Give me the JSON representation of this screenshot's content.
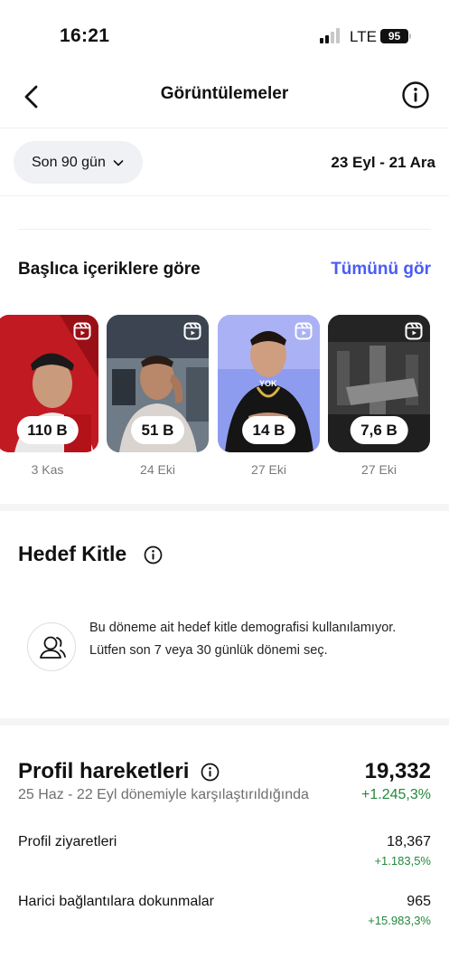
{
  "status_bar": {
    "time": "16:21",
    "network": "LTE",
    "battery": "95"
  },
  "header": {
    "title": "Görüntülemeler",
    "back_icon": "chevron-left-icon",
    "info_icon": "info-icon"
  },
  "filter": {
    "range_label": "Son 90 gün",
    "date_range": "23 Eyl - 21 Ara"
  },
  "top_content": {
    "title": "Başlıca içeriklere göre",
    "see_all": "Tümünü gör",
    "accent_color": "#4a5cf5",
    "items": [
      {
        "views": "110 B",
        "date": "3 Kas"
      },
      {
        "views": "51 B",
        "date": "24 Eki"
      },
      {
        "views": "14 B",
        "date": "27 Eki"
      },
      {
        "views": "7,6 B",
        "date": "27 Eki"
      }
    ],
    "reel_icon": "reels-icon"
  },
  "audience": {
    "title": "Hedef Kitle",
    "message": "Bu döneme ait hedef kitle demografisi kullanılamıyor. Lütfen son 7 veya 30 günlük dönemi seç.",
    "icon": "people-icon"
  },
  "profile_activity": {
    "title": "Profil hareketleri",
    "total": "19,332",
    "comparison": "25 Haz - 22 Eyl dönemiyle karşılaştırıldığında",
    "total_change": "+1.245,3%",
    "positive_color": "#23883c",
    "rows": [
      {
        "label": "Profil ziyaretleri",
        "value": "18,367",
        "change": "+1.183,5%"
      },
      {
        "label": "Harici bağlantılara dokunmalar",
        "value": "965",
        "change": "+15.983,3%"
      }
    ]
  }
}
